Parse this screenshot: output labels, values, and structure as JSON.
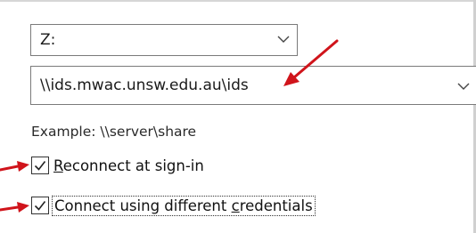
{
  "drive": {
    "selected": "Z:"
  },
  "folder": {
    "value": "\\\\ids.mwac.unsw.edu.au\\ids"
  },
  "example_text": "Example: \\\\server\\share",
  "reconnect": {
    "checked": true,
    "label_pre": "",
    "label_access_key": "R",
    "label_post": "econnect at sign-in"
  },
  "credentials": {
    "checked": true,
    "label_pre": "Connect using different ",
    "label_access_key": "c",
    "label_post": "redentials"
  },
  "colors": {
    "annotation_arrow": "#d0141b",
    "border": "#7a7a7a"
  },
  "icons": {
    "dropdown": "chevron-down-icon",
    "check": "checkmark-icon",
    "annotation": "red-arrow-icon"
  }
}
